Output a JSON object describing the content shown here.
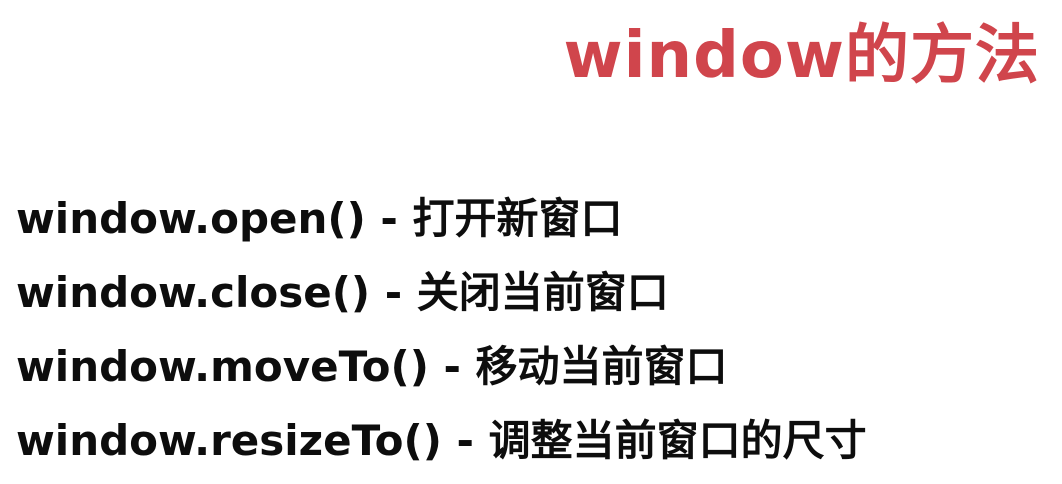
{
  "title": "window的方法",
  "methods": [
    {
      "text": "window.open() - 打开新窗口"
    },
    {
      "text": "window.close() - 关闭当前窗口"
    },
    {
      "text": "window.moveTo() - 移动当前窗口"
    },
    {
      "text": "window.resizeTo() - 调整当前窗口的尺寸"
    }
  ],
  "colors": {
    "title": "#d0454c",
    "text": "#0d0d0d",
    "background": "#ffffff"
  }
}
